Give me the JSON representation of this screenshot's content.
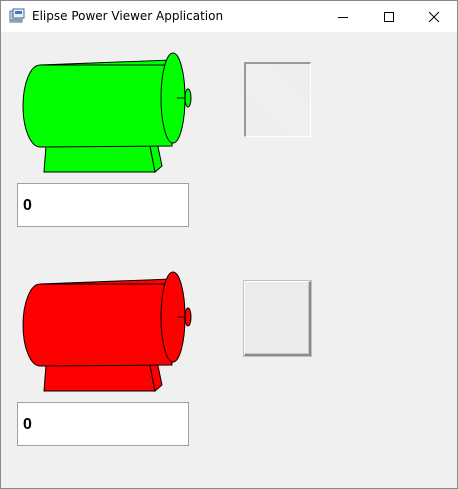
{
  "window": {
    "title": "Elipse Power Viewer Application"
  },
  "icons": {
    "app": "app-icon",
    "minimize": "minimize-icon",
    "maximize": "maximize-icon",
    "close": "close-icon"
  },
  "colors": {
    "motor_1_state": "#00ff00",
    "motor_2_state": "#ff0000",
    "window_background": "#f0f0f0"
  },
  "motors": [
    {
      "value": "0",
      "toggle_state": "pressed"
    },
    {
      "value": "0",
      "toggle_state": "raised"
    }
  ]
}
